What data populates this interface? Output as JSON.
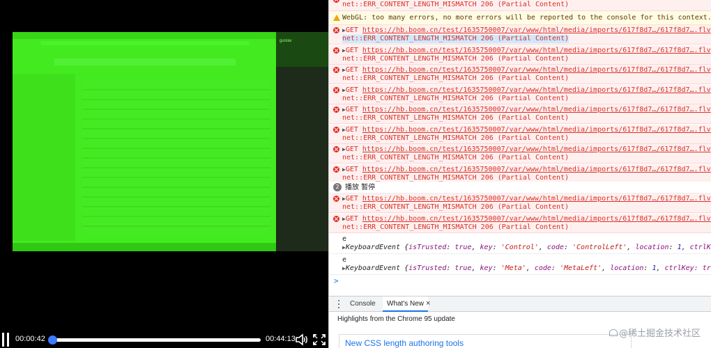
{
  "player": {
    "time_current": "00:00:42",
    "time_total": "00:44:13",
    "progress": 0.016,
    "accent_color": "#3d7bff",
    "video": {
      "tint_color": "#3fe81c",
      "overlay_label": "gustav"
    }
  },
  "console": {
    "top_error_line": "net::ERR_CONTENT_LENGTH_MISMATCH 206 (Partial Content)",
    "warning": "WebGL: too many errors, no more errors will be reported to the console for this context.",
    "errors_a": [
      {
        "method": "GET",
        "url": "https://hb.boom.cn/test/1635750007/var/www/html/media/imports/617f8d7…/617f8d7….flv",
        "detail": "net::ERR_CONTENT_LENGTH_MISMATCH 206 (Partial Content)"
      },
      {
        "method": "GET",
        "url": "https://hb.boom.cn/test/1635750007/var/www/html/media/imports/617f8d7…/617f8d7….flv",
        "detail": "net::ERR_CONTENT_LENGTH_MISMATCH 206 (Partial Content)"
      },
      {
        "method": "GET",
        "url": "https://hb.boom.cn/test/1635750007/var/www/html/media/imports/617f8d7…/617f8d7….flv",
        "detail": "net::ERR_CONTENT_LENGTH_MISMATCH 206 (Partial Content)"
      },
      {
        "method": "GET",
        "url": "https://hb.boom.cn/test/1635750007/var/www/html/media/imports/617f8d7…/617f8d7….flv",
        "detail": "net::ERR_CONTENT_LENGTH_MISMATCH 206 (Partial Content)"
      },
      {
        "method": "GET",
        "url": "https://hb.boom.cn/test/1635750007/var/www/html/media/imports/617f8d7…/617f8d7….flv",
        "detail": "net::ERR_CONTENT_LENGTH_MISMATCH 206 (Partial Content)"
      },
      {
        "method": "GET",
        "url": "https://hb.boom.cn/test/1635750007/var/www/html/media/imports/617f8d7…/617f8d7….flv",
        "detail": "net::ERR_CONTENT_LENGTH_MISMATCH 206 (Partial Content)"
      },
      {
        "method": "GET",
        "url": "https://hb.boom.cn/test/1635750007/var/www/html/media/imports/617f8d7…/617f8d7….flv",
        "detail": "net::ERR_CONTENT_LENGTH_MISMATCH 206 (Partial Content)"
      },
      {
        "method": "GET",
        "url": "https://hb.boom.cn/test/1635750007/var/www/html/media/imports/617f8d7…/617f8d7….flv",
        "detail": "net::ERR_CONTENT_LENGTH_MISMATCH 206 (Partial Content)"
      }
    ],
    "group": {
      "count": "2",
      "text": "播放 暂停"
    },
    "errors_b": [
      {
        "method": "GET",
        "url": "https://hb.boom.cn/test/1635750007/var/www/html/media/imports/617f8d7…/617f8d7….flv",
        "detail": "net::ERR_CONTENT_LENGTH_MISMATCH 206 (Partial Content)"
      },
      {
        "method": "GET",
        "url": "https://hb.boom.cn/test/1635750007/var/www/html/media/imports/617f8d7…/617f8d7….flv",
        "detail": "net::ERR_CONTENT_LENGTH_MISMATCH 206 (Partial Content)"
      }
    ],
    "events": [
      {
        "var": "e",
        "type": "KeyboardEvent",
        "isTrusted": "true",
        "key": "'Control'",
        "code": "'ControlLeft'",
        "location": "1",
        "tail": "ctrlKey"
      },
      {
        "var": "e",
        "type": "KeyboardEvent",
        "isTrusted": "true",
        "key": "'Meta'",
        "code": "'MetaLeft'",
        "location": "1",
        "tail": "ctrlKey: true"
      }
    ],
    "prompt": ">"
  },
  "drawer": {
    "tabs": [
      "Console",
      "What's New"
    ],
    "close_glyph": "×",
    "highlights": "Highlights from the Chrome 95 update",
    "card_title": "New CSS length authoring tools",
    "watermark": "@稀土掘金技术社区"
  }
}
